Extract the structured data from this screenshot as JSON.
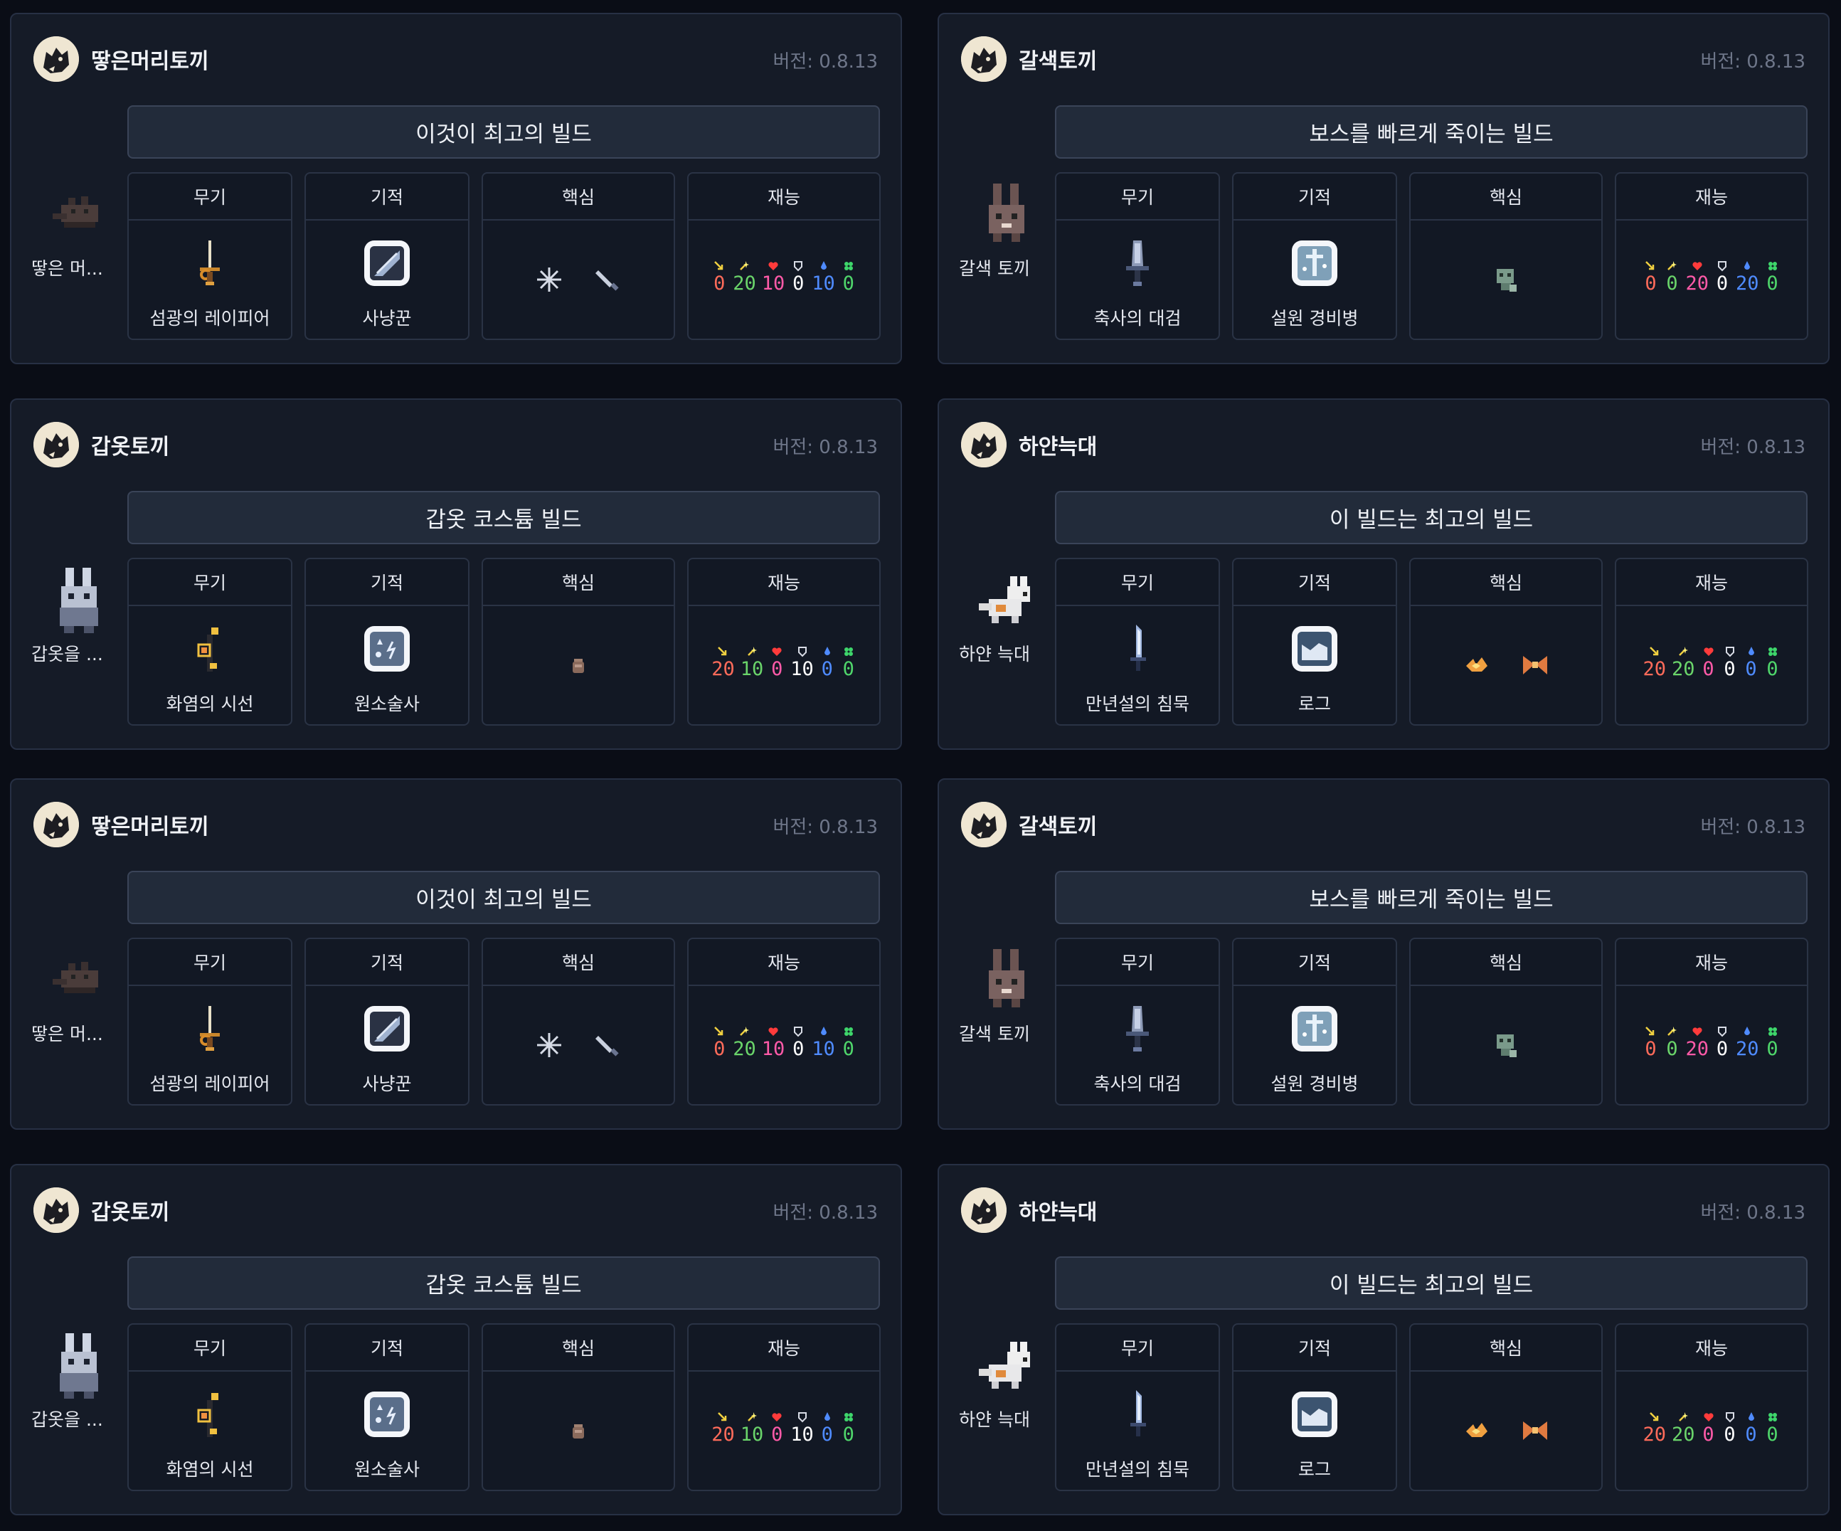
{
  "labels": {
    "weapon": "무기",
    "miracle": "기적",
    "core": "핵심",
    "talent": "재능"
  },
  "talent_colors": [
    "#ff6b5a",
    "#6ad46a",
    "#ff5aa8",
    "#ffffff",
    "#4f8bff",
    "#4fd66b"
  ],
  "talent_icons": [
    "arrow-attack-icon",
    "sparkle-skill-icon",
    "heart-icon",
    "shield-icon",
    "drop-icon",
    "clover-icon"
  ],
  "cards": [
    {
      "name": "땋은머리토끼",
      "version": "버전: 0.8.13",
      "title": "이것이 최고의 빌드",
      "character": "땋은 머...",
      "char_icon": "braided-rabbit-icon",
      "weapon": "섬광의 레이피어",
      "weapon_icon": "rapier-icon",
      "miracle": "사냥꾼",
      "miracle_icon": "hunter-miracle-icon",
      "core_icons": [
        "snowflake-core-icon",
        "dagger-core-icon"
      ],
      "talents": [
        "0",
        "20",
        "10",
        "0",
        "10",
        "0"
      ]
    },
    {
      "name": "갈색토끼",
      "version": "버전: 0.8.13",
      "title": "보스를 빠르게 죽이는 빌드",
      "character": "갈색 토끼",
      "char_icon": "brown-rabbit-icon",
      "weapon": "축사의 대검",
      "weapon_icon": "greatsword-icon",
      "miracle": "설원 경비병",
      "miracle_icon": "snowfield-guard-miracle-icon",
      "core_icons": [
        "skull-core-icon"
      ],
      "talents": [
        "0",
        "0",
        "20",
        "0",
        "20",
        "0"
      ]
    },
    {
      "name": "갑옷토끼",
      "version": "버전: 0.8.13",
      "title": "갑옷 코스튬 빌드",
      "character": "갑옷을 ...",
      "char_icon": "armored-rabbit-icon",
      "weapon": "화염의 시선",
      "weapon_icon": "flame-staff-icon",
      "miracle": "원소술사",
      "miracle_icon": "elementalist-miracle-icon",
      "core_icons": [
        "jar-core-icon"
      ],
      "talents": [
        "20",
        "10",
        "0",
        "10",
        "0",
        "0"
      ]
    },
    {
      "name": "하얀늑대",
      "version": "버전: 0.8.13",
      "title": "이 빌드는 최고의 빌드",
      "character": "하얀 늑대",
      "char_icon": "white-wolf-icon",
      "weapon": "만년설의 침묵",
      "weapon_icon": "ice-blade-icon",
      "miracle": "로그",
      "miracle_icon": "rogue-miracle-icon",
      "core_icons": [
        "fire-core-icon",
        "ribbon-core-icon"
      ],
      "talents": [
        "20",
        "20",
        "0",
        "0",
        "0",
        "0"
      ]
    },
    {
      "name": "땋은머리토끼",
      "version": "버전: 0.8.13",
      "title": "이것이 최고의 빌드",
      "character": "땋은 머...",
      "char_icon": "braided-rabbit-icon",
      "weapon": "섬광의 레이피어",
      "weapon_icon": "rapier-icon",
      "miracle": "사냥꾼",
      "miracle_icon": "hunter-miracle-icon",
      "core_icons": [
        "snowflake-core-icon",
        "dagger-core-icon"
      ],
      "talents": [
        "0",
        "20",
        "10",
        "0",
        "10",
        "0"
      ]
    },
    {
      "name": "갈색토끼",
      "version": "버전: 0.8.13",
      "title": "보스를 빠르게 죽이는 빌드",
      "character": "갈색 토끼",
      "char_icon": "brown-rabbit-icon",
      "weapon": "축사의 대검",
      "weapon_icon": "greatsword-icon",
      "miracle": "설원 경비병",
      "miracle_icon": "snowfield-guard-miracle-icon",
      "core_icons": [
        "skull-core-icon"
      ],
      "talents": [
        "0",
        "0",
        "20",
        "0",
        "20",
        "0"
      ]
    },
    {
      "name": "갑옷토끼",
      "version": "버전: 0.8.13",
      "title": "갑옷 코스튬 빌드",
      "character": "갑옷을 ...",
      "char_icon": "armored-rabbit-icon",
      "weapon": "화염의 시선",
      "weapon_icon": "flame-staff-icon",
      "miracle": "원소술사",
      "miracle_icon": "elementalist-miracle-icon",
      "core_icons": [
        "jar-core-icon"
      ],
      "talents": [
        "20",
        "10",
        "0",
        "10",
        "0",
        "0"
      ]
    },
    {
      "name": "하얀늑대",
      "version": "버전: 0.8.13",
      "title": "이 빌드는 최고의 빌드",
      "character": "하얀 늑대",
      "char_icon": "white-wolf-icon",
      "weapon": "만년설의 침묵",
      "weapon_icon": "ice-blade-icon",
      "miracle": "로그",
      "miracle_icon": "rogue-miracle-icon",
      "core_icons": [
        "fire-core-icon",
        "ribbon-core-icon"
      ],
      "talents": [
        "20",
        "20",
        "0",
        "0",
        "0",
        "0"
      ]
    }
  ]
}
